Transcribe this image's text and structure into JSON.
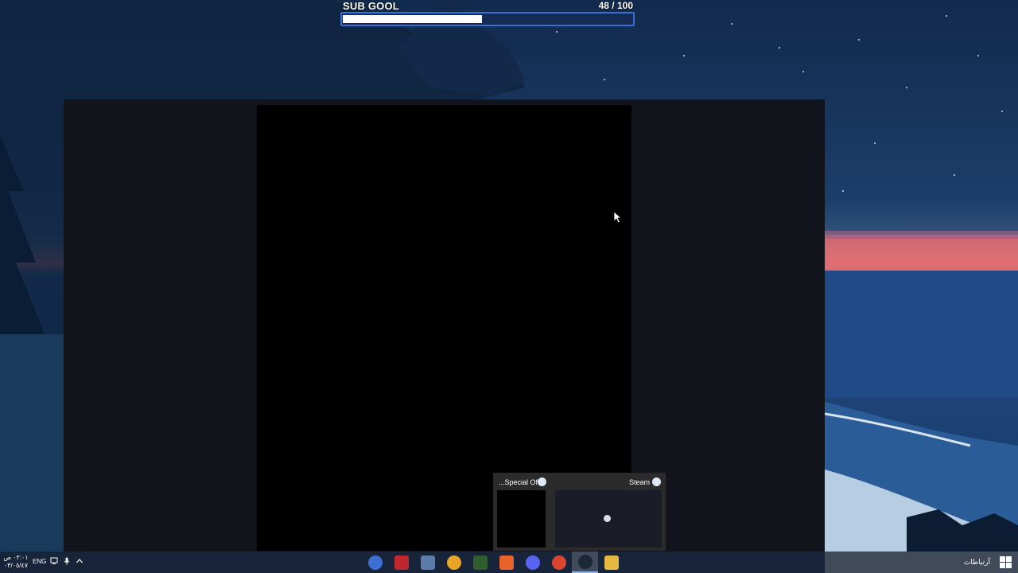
{
  "overlay": {
    "title": "SUB GOOL",
    "current": "48",
    "separator": " / ",
    "target": "100",
    "progress_fraction": 0.48,
    "bar_border_color": "#3b6ed1",
    "fill_color": "#ffffff"
  },
  "window": {
    "background": "#12141b",
    "content_background": "#000000"
  },
  "thumbnails": [
    {
      "title": "...Special Off",
      "icon": "steam-icon"
    },
    {
      "title": "Steam",
      "icon": "steam-icon"
    }
  ],
  "taskbar": {
    "clock_time": "٠٢:٠١ ص",
    "clock_date": "٠٣/٠٥/٤٧",
    "language": "ENG",
    "notifications_label": "آرتباطات",
    "tray_icons": [
      "network-icon",
      "microphone-icon",
      "chevron-up-icon"
    ],
    "apps": [
      {
        "name": "chrome-canary-icon",
        "color": "#3b6fd1",
        "active": false
      },
      {
        "name": "app-red-icon",
        "color": "#c0262d",
        "active": false
      },
      {
        "name": "notepad-icon",
        "color": "#5b7ca8",
        "active": false
      },
      {
        "name": "clipchamp-icon",
        "color": "#e8a528",
        "active": false
      },
      {
        "name": "xbox-icon",
        "color": "#2f5d2f",
        "active": false
      },
      {
        "name": "adobe-icon",
        "color": "#e8622b",
        "active": false
      },
      {
        "name": "discord-icon",
        "color": "#5865f2",
        "active": false
      },
      {
        "name": "chrome-icon",
        "color": "#d9452f",
        "active": false
      },
      {
        "name": "steam-icon",
        "color": "#1b2838",
        "active": true
      },
      {
        "name": "file-explorer-icon",
        "color": "#e5b941",
        "active": false
      }
    ]
  }
}
